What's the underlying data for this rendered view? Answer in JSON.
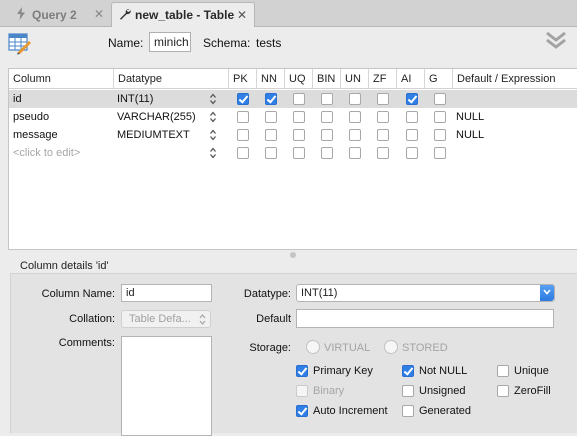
{
  "tabs": [
    {
      "label": "Query 2",
      "icon": "lightning-icon",
      "active": false
    },
    {
      "label": "new_table - Table",
      "icon": "wrench-icon",
      "active": true
    }
  ],
  "header": {
    "name_label": "Name:",
    "name_value": "minich",
    "schema_label": "Schema:",
    "schema_value": "tests"
  },
  "grid": {
    "columns": [
      "Column",
      "Datatype",
      "PK",
      "NN",
      "UQ",
      "BIN",
      "UN",
      "ZF",
      "AI",
      "G",
      "Default / Expression"
    ],
    "rows": [
      {
        "name": "id",
        "datatype": "INT(11)",
        "pk": true,
        "nn": true,
        "uq": false,
        "bin": false,
        "un": false,
        "zf": false,
        "ai": true,
        "g": false,
        "default": "",
        "selected": true
      },
      {
        "name": "pseudo",
        "datatype": "VARCHAR(255)",
        "pk": false,
        "nn": false,
        "uq": false,
        "bin": false,
        "un": false,
        "zf": false,
        "ai": false,
        "g": false,
        "default": "NULL",
        "selected": false
      },
      {
        "name": "message",
        "datatype": "MEDIUMTEXT",
        "pk": false,
        "nn": false,
        "uq": false,
        "bin": false,
        "un": false,
        "zf": false,
        "ai": false,
        "g": false,
        "default": "NULL",
        "selected": false
      }
    ],
    "placeholder_row": "<click to edit>"
  },
  "details": {
    "title": "Column details 'id'",
    "column_name_label": "Column Name:",
    "column_name_value": "id",
    "collation_label": "Collation:",
    "collation_value": "Table Defa...",
    "comments_label": "Comments:",
    "datatype_label": "Datatype:",
    "datatype_value": "INT(11)",
    "default_label": "Default",
    "default_value": "",
    "storage_label": "Storage:",
    "storage_virtual": "VIRTUAL",
    "storage_stored": "STORED",
    "flags": {
      "primary_key": {
        "label": "Primary Key",
        "checked": true
      },
      "not_null": {
        "label": "Not NULL",
        "checked": true
      },
      "unique": {
        "label": "Unique",
        "checked": false
      },
      "binary": {
        "label": "Binary",
        "checked": false
      },
      "unsigned": {
        "label": "Unsigned",
        "checked": false
      },
      "zerofill": {
        "label": "ZeroFill",
        "checked": false
      },
      "auto_increment": {
        "label": "Auto Increment",
        "checked": true
      },
      "generated": {
        "label": "Generated",
        "checked": false
      }
    }
  },
  "colors": {
    "accent": "#2f7fe6",
    "selected_row": "#dcdcdc"
  }
}
